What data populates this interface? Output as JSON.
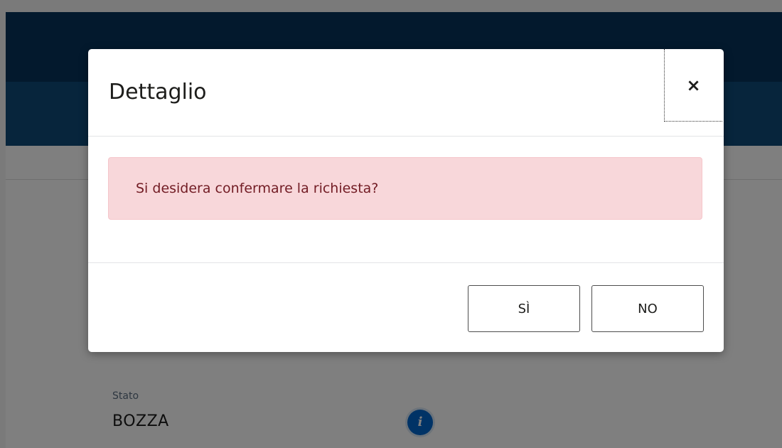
{
  "background": {
    "status_label": "Stato",
    "status_value": "BOZZA",
    "info_icon_glyph": "i"
  },
  "modal": {
    "title": "Dettaglio",
    "close_glyph": "×",
    "message": "Si desidera confermare la richiesta?",
    "yes_label": "SÌ",
    "no_label": "NO"
  },
  "colors": {
    "header_dark": "#06335a",
    "header_mid": "#0f4a78",
    "alert_bg": "#f8d7da",
    "alert_text": "#721c24",
    "info_icon": "#0066cc"
  },
  "icons": {
    "close": "close-icon",
    "info": "info-icon"
  }
}
